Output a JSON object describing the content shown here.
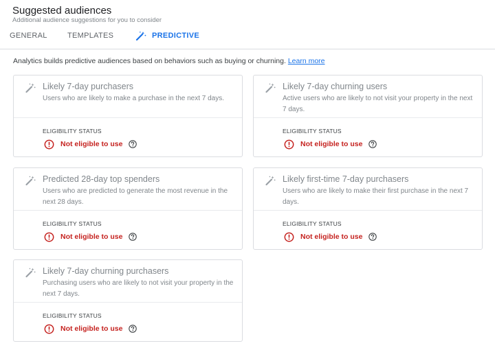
{
  "header": {
    "title": "Suggested audiences",
    "subtitle": "Additional audience suggestions for you to consider"
  },
  "tabs": [
    {
      "label": "GENERAL",
      "active": false
    },
    {
      "label": "TEMPLATES",
      "active": false
    },
    {
      "label": "PREDICTIVE",
      "active": true,
      "icon": "magic-wand-icon"
    }
  ],
  "intro": {
    "text": "Analytics builds predictive audiences based on behaviors such as buying or churning.",
    "link": "Learn more"
  },
  "colors": {
    "accent": "#1a73e8",
    "error": "#c5221f",
    "muted_text": "#80868b",
    "border": "#dadce0"
  },
  "eligibility_label": "ELIGIBILITY STATUS",
  "cards": [
    {
      "title": "Likely 7-day purchasers",
      "description": "Users who are likely to make a purchase in the next 7 days.",
      "status": "Not eligible to use"
    },
    {
      "title": "Likely 7-day churning users",
      "description": "Active users who are likely to not visit your property in the next 7 days.",
      "status": "Not eligible to use"
    },
    {
      "title": "Predicted 28-day top spenders",
      "description": "Users who are predicted to generate the most revenue in the next 28 days.",
      "status": "Not eligible to use"
    },
    {
      "title": "Likely first-time 7-day purchasers",
      "description": "Users who are likely to make their first purchase in the next 7 days.",
      "status": "Not eligible to use"
    },
    {
      "title": "Likely 7-day churning purchasers",
      "description": "Purchasing users who are likely to not visit your property in the next 7 days.",
      "status": "Not eligible to use"
    }
  ]
}
